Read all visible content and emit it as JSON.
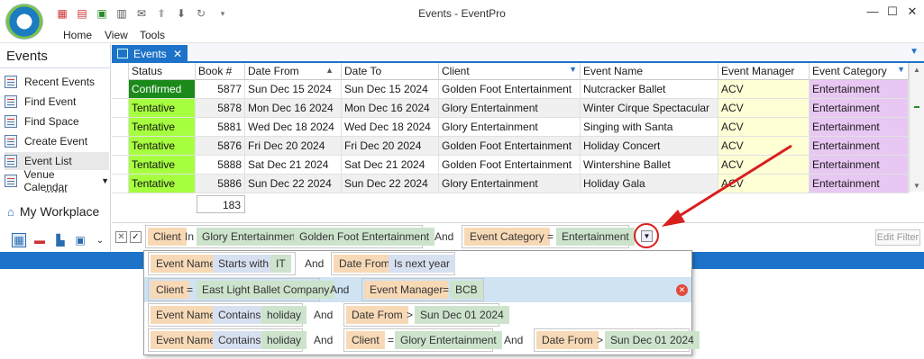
{
  "window": {
    "title": "Events - EventPro",
    "minimize": "—",
    "maximize": "☐",
    "close": "✕",
    "menu": [
      "Home",
      "View",
      "Tools"
    ]
  },
  "quick_access": [
    "calendar-red-icon",
    "grid-red-icon",
    "cart-green-icon",
    "report-icon",
    "mail-icon",
    "up-circle-icon",
    "down-circle-icon",
    "refresh-icon",
    "customize-arrow-icon"
  ],
  "sidebar": {
    "header": "Events",
    "items": [
      {
        "label": "Recent Events"
      },
      {
        "label": "Find Event"
      },
      {
        "label": "Find Space"
      },
      {
        "label": "Create Event"
      },
      {
        "label": "Event List"
      },
      {
        "label": "Venue Calendar"
      }
    ],
    "workplace_label": "My Workplace"
  },
  "tab": {
    "label": "Events",
    "close": "✕"
  },
  "grid": {
    "columns": [
      "Status",
      "Book #",
      "Date From",
      "Date To",
      "Client",
      "Event Name",
      "Event Manager",
      "Event Category"
    ],
    "rows": [
      {
        "status": "Confirmed",
        "book": "5877",
        "date_from": "Sun Dec 15 2024",
        "date_to": "Sun Dec 15 2024",
        "client": "Golden Foot Entertainment",
        "event_name": "Nutcracker Ballet",
        "manager": "ACV",
        "category": "Entertainment"
      },
      {
        "status": "Tentative",
        "book": "5878",
        "date_from": "Mon Dec 16 2024",
        "date_to": "Mon Dec 16 2024",
        "client": "Glory Entertainment",
        "event_name": "Winter Cirque Spectacular",
        "manager": "ACV",
        "category": "Entertainment"
      },
      {
        "status": "Tentative",
        "book": "5881",
        "date_from": "Wed Dec 18 2024",
        "date_to": "Wed Dec 18 2024",
        "client": "Glory Entertainment",
        "event_name": "Singing with Santa",
        "manager": "ACV",
        "category": "Entertainment"
      },
      {
        "status": "Tentative",
        "book": "5876",
        "date_from": "Fri Dec 20 2024",
        "date_to": "Fri Dec 20 2024",
        "client": "Golden Foot Entertainment",
        "event_name": "Holiday Concert",
        "manager": "ACV",
        "category": "Entertainment"
      },
      {
        "status": "Tentative",
        "book": "5888",
        "date_from": "Sat Dec 21 2024",
        "date_to": "Sat Dec 21 2024",
        "client": "Golden Foot Entertainment",
        "event_name": "Wintershine Ballet",
        "manager": "ACV",
        "category": "Entertainment"
      },
      {
        "status": "Tentative",
        "book": "5886",
        "date_from": "Sun Dec 22 2024",
        "date_to": "Sun Dec 22 2024",
        "client": "Glory Entertainment",
        "event_name": "Holiday Gala",
        "manager": "ACV",
        "category": "Entertainment"
      }
    ],
    "summary_count": "183"
  },
  "filter": {
    "field1": "Client",
    "op1": "In",
    "val1a": "Glory Entertainment",
    "val1b": "Golden Foot Entertainment",
    "and": "And",
    "field2": "Event Category",
    "op2": "=",
    "val2": "Entertainment",
    "edit_label": "Edit Filter",
    "checked": "✓",
    "remove": "✕"
  },
  "mru": [
    [
      {
        "t": "Event Name",
        "k": "field"
      },
      {
        "t": "Starts with",
        "k": "op"
      },
      {
        "t": "IT",
        "k": "val"
      },
      {
        "t": "And",
        "k": "plain"
      },
      {
        "t": "Date From",
        "k": "field"
      },
      {
        "t": "Is next year",
        "k": "op"
      }
    ],
    [
      {
        "t": "Client",
        "k": "field"
      },
      {
        "t": "=",
        "k": "plain"
      },
      {
        "t": "East Light Ballet Company",
        "k": "val"
      },
      {
        "t": "And",
        "k": "plain"
      },
      {
        "t": "Event Manager",
        "k": "field"
      },
      {
        "t": "=",
        "k": "plain"
      },
      {
        "t": "BCB",
        "k": "val"
      }
    ],
    [
      {
        "t": "Event Name",
        "k": "field"
      },
      {
        "t": "Contains",
        "k": "op"
      },
      {
        "t": "holiday",
        "k": "val"
      },
      {
        "t": "And",
        "k": "plain"
      },
      {
        "t": "Date From",
        "k": "field"
      },
      {
        "t": ">",
        "k": "plain"
      },
      {
        "t": "Sun Dec 01 2024",
        "k": "val"
      }
    ],
    [
      {
        "t": "Event Name",
        "k": "field"
      },
      {
        "t": "Contains",
        "k": "op"
      },
      {
        "t": "holiday",
        "k": "val"
      },
      {
        "t": "And",
        "k": "plain"
      },
      {
        "t": "Client",
        "k": "field"
      },
      {
        "t": "=",
        "k": "plain"
      },
      {
        "t": "Glory Entertainment",
        "k": "val"
      },
      {
        "t": "And",
        "k": "plain"
      },
      {
        "t": "Date From",
        "k": "field"
      },
      {
        "t": ">",
        "k": "plain"
      },
      {
        "t": "Sun Dec 01 2024",
        "k": "val"
      }
    ]
  ],
  "colors": {
    "accent": "#1d73c9",
    "confirmed": "#1b8a1b",
    "tentative": "#a6ff3f",
    "manager": "#ffffd6",
    "category": "#e8c7f3",
    "annotation": "#d91e1e"
  }
}
